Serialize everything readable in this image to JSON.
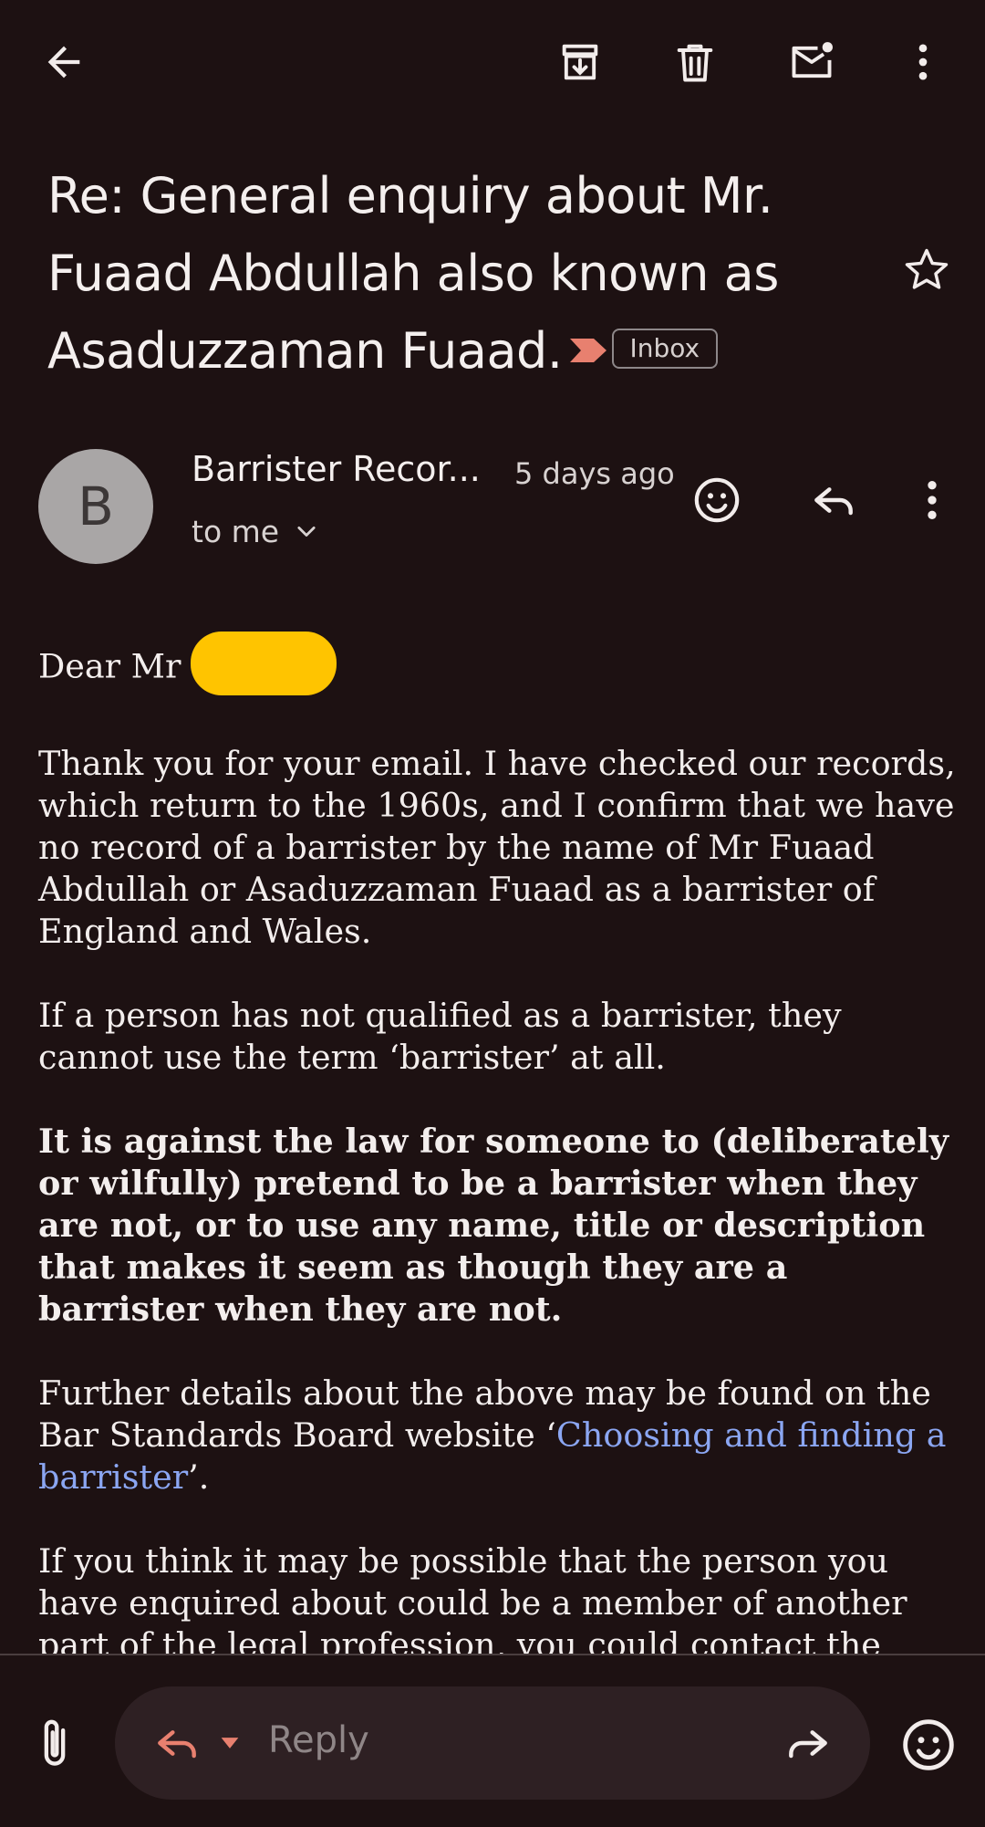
{
  "toolbar": {
    "back_icon": "arrow-left-icon",
    "archive_icon": "archive-icon",
    "delete_icon": "trash-icon",
    "mark_unread_icon": "mark-unread-icon",
    "more_icon": "more-vert-icon"
  },
  "subject": {
    "text": "Re: General enquiry about Mr. Fuaad Abdullah also known as Asaduzzaman Fuaad.",
    "label": "Inbox",
    "importance_color": "#e8806f"
  },
  "message": {
    "avatar_letter": "B",
    "sender": "Barrister Recor...",
    "time": "5 days ago",
    "recipient": "to me"
  },
  "body": {
    "greeting": "Dear Mr",
    "para1": "Thank you for your email. I have checked our records, which return to the 1960s, and I confirm that we have no record of a barrister by the name of Mr Fuaad Abdullah or Asaduzzaman Fuaad as a barrister of England and Wales.",
    "para2": "If a person has not qualified as a barrister, they cannot use the term ‘barrister’ at all.",
    "para3": "It is against the law for someone to (deliberately or wilfully) pretend to be a barrister when they are not, or to use any name, title or description that makes it seem as though they are a barrister when they are not.",
    "para4_before": "Further details about the above may be found on the Bar Standards Board website ‘",
    "para4_link": "Choosing and finding a barrister",
    "para4_after": "’.",
    "para5": "If you think it may be possible that the person you have enquired about could be a member of another part of the legal profession, you could contact the"
  },
  "reply_bar": {
    "placeholder": "Reply"
  },
  "colors": {
    "background": "#1d1112",
    "link": "#8ba6f2",
    "redaction": "#ffc400"
  }
}
